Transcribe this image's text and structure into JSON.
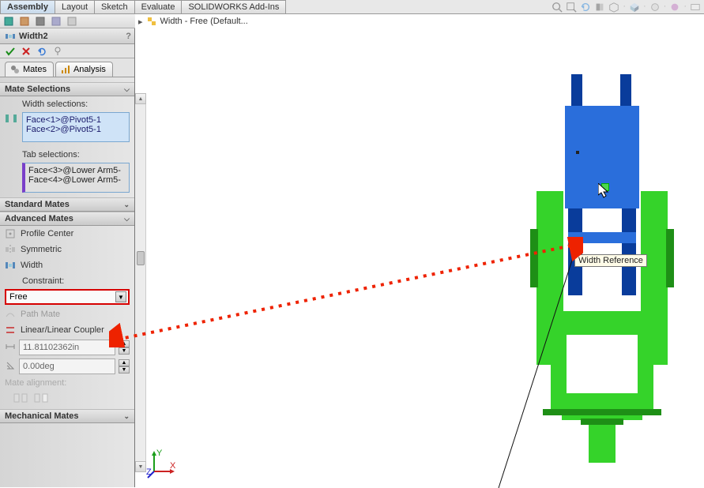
{
  "top_tabs": {
    "t0": "Assembly",
    "t1": "Layout",
    "t2": "Sketch",
    "t3": "Evaluate",
    "t4": "SOLIDWORKS Add-Ins"
  },
  "feature": {
    "name": "Width2"
  },
  "pm_tabs": {
    "mates": "Mates",
    "analysis": "Analysis"
  },
  "mate_selections": {
    "header": "Mate Selections",
    "width_label": "Width selections:",
    "width_items": {
      "i0": "Face<1>@Pivot5-1",
      "i1": "Face<2>@Pivot5-1"
    },
    "tab_label": "Tab selections:",
    "tab_items": {
      "i0": "Face<3>@Lower Arm5-",
      "i1": "Face<4>@Lower Arm5-"
    }
  },
  "standard_mates": {
    "header": "Standard Mates"
  },
  "advanced_mates": {
    "header": "Advanced Mates",
    "profile_center": "Profile Center",
    "symmetric": "Symmetric",
    "width": "Width",
    "constraint_label": "Constraint:",
    "constraint_value": "Free",
    "path_mate": "Path Mate",
    "linear_coupler": "Linear/Linear Coupler",
    "distance": "11.81102362in",
    "angle": "0.00deg",
    "mate_alignment": "Mate alignment:"
  },
  "mechanical_mates": {
    "header": "Mechanical Mates"
  },
  "viewport": {
    "tree_root": "Width - Free  (Default...",
    "tooltip": "Width Reference"
  },
  "triad": {
    "x": "X",
    "y": "Y",
    "z": "Z"
  }
}
